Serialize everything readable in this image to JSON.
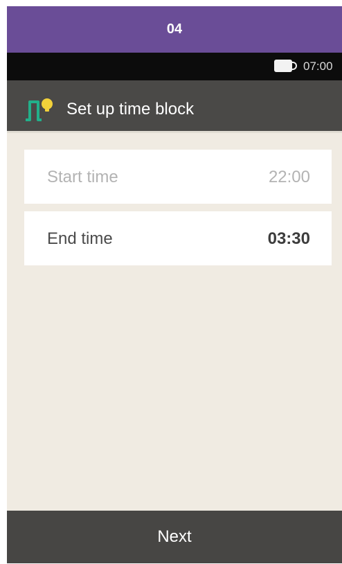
{
  "step_banner": {
    "number": "04",
    "color": "#6a4d97"
  },
  "status_bar": {
    "battery_icon": "battery-icon",
    "time": "07:00"
  },
  "title_bar": {
    "icon": "time-block-icon",
    "title": "Set up time block"
  },
  "time_rows": [
    {
      "label": "Start time",
      "value": "22:00",
      "state": "dimmed"
    },
    {
      "label": "End time",
      "value": "03:30",
      "state": "active"
    }
  ],
  "footer": {
    "next_label": "Next"
  },
  "colors": {
    "background": "#f0ebe2",
    "header_dark": "#4a4947",
    "icon_green": "#22b08a",
    "icon_yellow": "#f2d13a"
  }
}
